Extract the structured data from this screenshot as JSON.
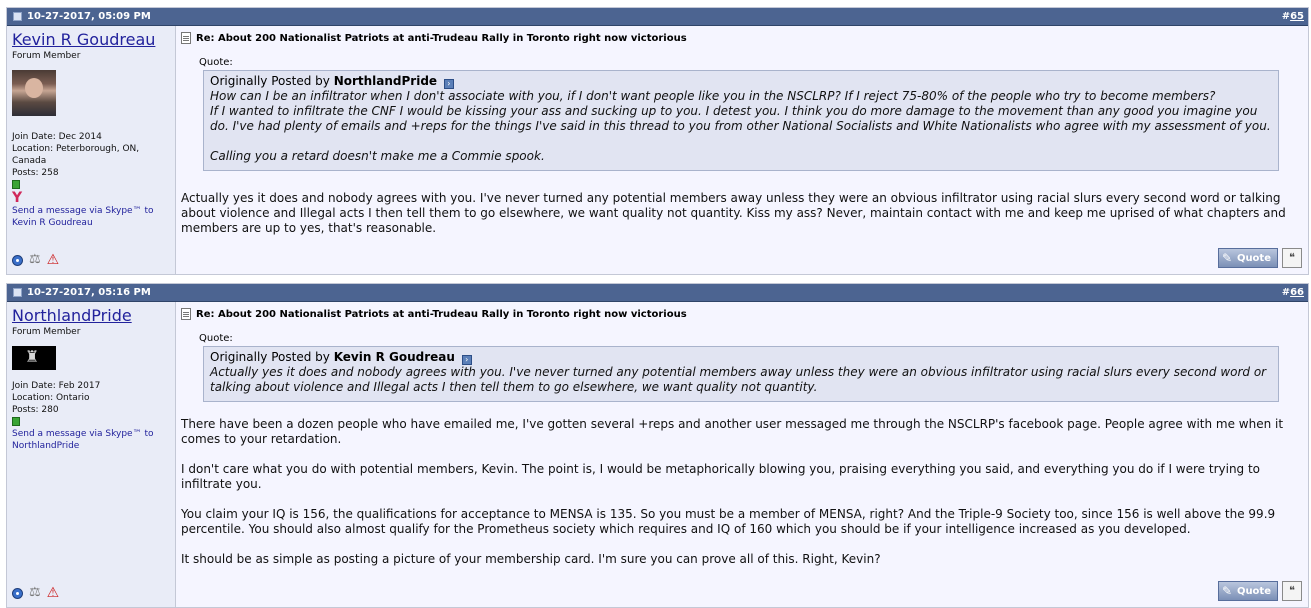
{
  "posts": [
    {
      "date": "10-27-2017, 05:09 PM",
      "number": "65",
      "user": {
        "name": "Kevin R Goudreau",
        "title": "Forum Member",
        "join_date": "Join Date: Dec 2014",
        "location": "Location: Peterborough, ON, Canada",
        "posts": "Posts: 258",
        "skype": "Send a message via Skype™ to Kevin R Goudreau"
      },
      "title": "Re: About 200 Nationalist Patriots at anti-Trudeau Rally in Toronto right now victorious",
      "quote_label": "Quote:",
      "quote_prefix": "Originally Posted by",
      "quote_author": "NorthlandPride",
      "quote_lines": [
        "How can I be an infiltrator when I don't associate with you, if I don't want people like you in the NSCLRP? If I reject 75-80% of the people who try to become members?",
        "If I wanted to infiltrate the CNF I would be kissing your ass and sucking up to you. I detest you. I think you do more damage to the movement than any good you imagine you do. I've had plenty of emails and +reps for the things I've said in this thread to you from other National Socialists and White Nationalists who agree with my assessment of you.",
        "",
        "Calling you a retard doesn't make me a Commie spook."
      ],
      "body": [
        "Actually yes it does and nobody agrees with you. I've never turned any potential members away unless they were an obvious infiltrator using racial slurs every second word or talking about violence and Illegal acts I then tell them to go elsewhere, we want quality not quantity. Kiss my ass? Never, maintain contact with me and keep me uprised of what chapters and members are up to yes, that's reasonable."
      ],
      "quote_button": "Quote"
    },
    {
      "date": "10-27-2017, 05:16 PM",
      "number": "66",
      "user": {
        "name": "NorthlandPride",
        "title": "Forum Member",
        "join_date": "Join Date: Feb 2017",
        "location": "Location: Ontario",
        "posts": "Posts: 280",
        "skype": "Send a message via Skype™ to NorthlandPride"
      },
      "title": "Re: About 200 Nationalist Patriots at anti-Trudeau Rally in Toronto right now victorious",
      "quote_label": "Quote:",
      "quote_prefix": "Originally Posted by",
      "quote_author": "Kevin R Goudreau",
      "quote_lines": [
        "Actually yes it does and nobody agrees with you. I've never turned any potential members away unless they were an obvious infiltrator using racial slurs every second word or talking about violence and Illegal acts I then tell them to go elsewhere, we want quality not quantity."
      ],
      "body": [
        "There have been a dozen people who have emailed me, I've gotten several +reps and another user messaged me through the NSCLRP's facebook page. People agree with me when it comes to your retardation.",
        "I don't care what you do with potential members, Kevin. The point is, I would be metaphorically blowing you, praising everything you said, and everything you do if I were trying to infiltrate you.",
        "You claim your IQ is 156, the qualifications for acceptance to MENSA is 135. So you must be a member of MENSA, right? And the Triple-9 Society too, since 156 is well above the 99.9 percentile. You should also almost qualify for the Prometheus society which requires and IQ of 160 which you should be if your intelligence increased as you developed.",
        "It should be as simple as posting a picture of your membership card. I'm sure you can prove all of this. Right, Kevin?"
      ],
      "quote_button": "Quote"
    }
  ]
}
